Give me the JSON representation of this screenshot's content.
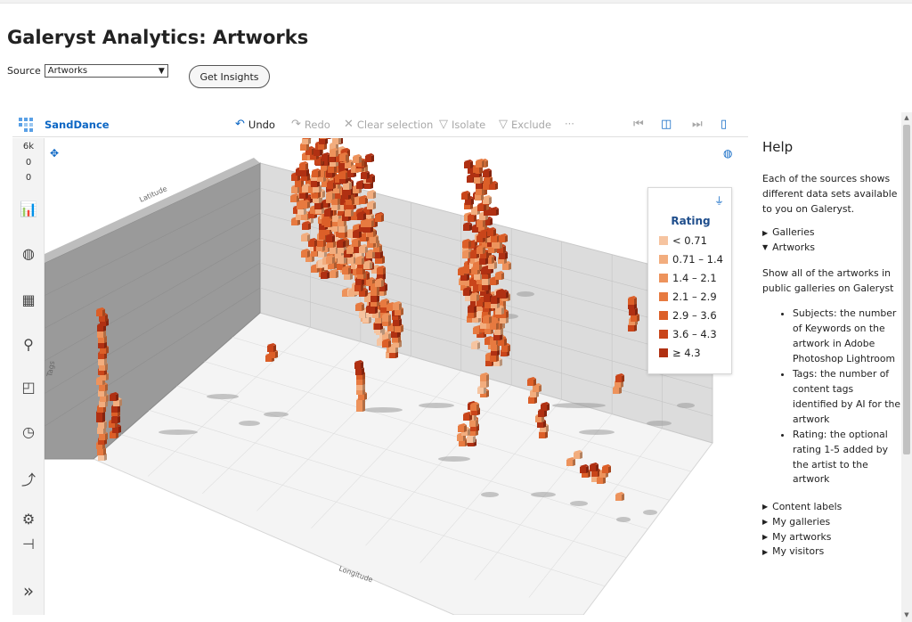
{
  "page": {
    "title": "Galeryst Analytics: Artworks"
  },
  "source": {
    "label": "Source",
    "selected": "Artworks"
  },
  "insights_button": "Get Insights",
  "toolbar": {
    "brand": "SandDance",
    "undo": "Undo",
    "redo": "Redo",
    "clear_selection": "Clear selection",
    "isolate": "Isolate",
    "exclude": "Exclude",
    "more": "···"
  },
  "rail": {
    "count_total": "6k",
    "count_selected": "0",
    "count_filtered": "0"
  },
  "axes": {
    "x": "Longitude",
    "y": "Latitude",
    "z": "Tags"
  },
  "legend": {
    "title": "Rating",
    "items": [
      {
        "label": "< 0.71",
        "color": "#f6c4a0"
      },
      {
        "label": "0.71 – 1.4",
        "color": "#f2ad7e"
      },
      {
        "label": "1.4 – 2.1",
        "color": "#ed935c"
      },
      {
        "label": "2.1 – 2.9",
        "color": "#e77a40"
      },
      {
        "label": "2.9 – 3.6",
        "color": "#dc5f28"
      },
      {
        "label": "3.6 – 4.3",
        "color": "#c9451a"
      },
      {
        "label": "≥ 4.3",
        "color": "#b03012"
      }
    ]
  },
  "help": {
    "title": "Help",
    "intro": "Each of the sources shows different data sets available to you on Galeryst.",
    "sections": [
      "Galleries",
      "Artworks"
    ],
    "artworks_desc": "Show all of the artworks in public galleries on Galeryst",
    "bullets": [
      "Subjects: the number of Keywords on the artwork in Adobe Photoshop Lightroom",
      "Tags: the number of content tags identified by AI for the artwork",
      "Rating: the optional rating 1-5 added by the artist to the artwork"
    ],
    "more_sections": [
      "Content labels",
      "My galleries",
      "My artworks",
      "My visitors"
    ]
  }
}
